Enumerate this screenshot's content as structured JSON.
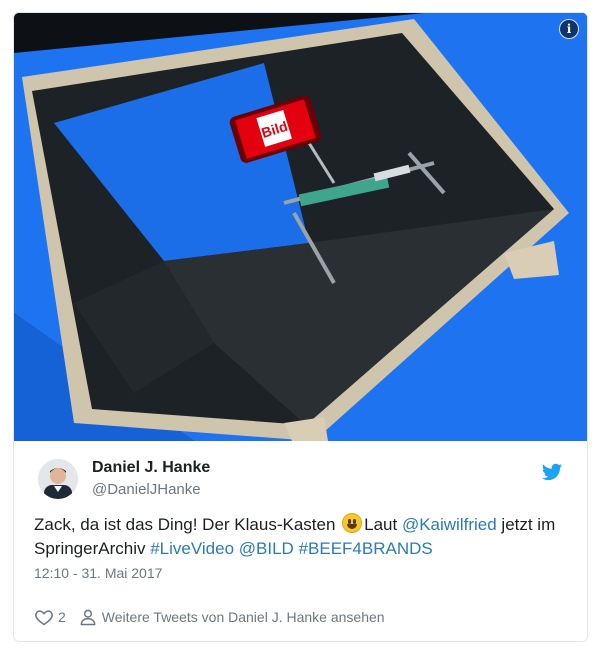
{
  "tweet": {
    "author_name": "Daniel J. Hanke",
    "author_handle": "@DanielJHanke",
    "text_1": "Zack, da ist das Ding! Der Klaus-Kasten ",
    "text_2": "Laut ",
    "mention_1": "@Kaiwilfried",
    "text_3": " jetzt im SpringerArchiv ",
    "hashtag_1": "#LiveVideo",
    "mention_2": "@BILD",
    "hashtag_2": "#BEEF4BRANDS",
    "timestamp": "12:10 - 31. Mai 2017",
    "like_count": "2",
    "more_tweets_label": "Weitere Tweets von Daniel J. Hanke ansehen",
    "phone_logo_text": "Bild",
    "info_label": "i"
  },
  "icons": {
    "info": "info-icon",
    "bird": "twitter-bird-icon",
    "heart": "heart-icon",
    "person": "person-icon",
    "emoji": "grinning-face-emoji"
  },
  "colors": {
    "link": "#2b7bb9",
    "twitter_blue": "#1da1f2",
    "secondary_text": "#697882",
    "screen_blue": "#1a6ff0",
    "bild_red": "#e3000f"
  }
}
